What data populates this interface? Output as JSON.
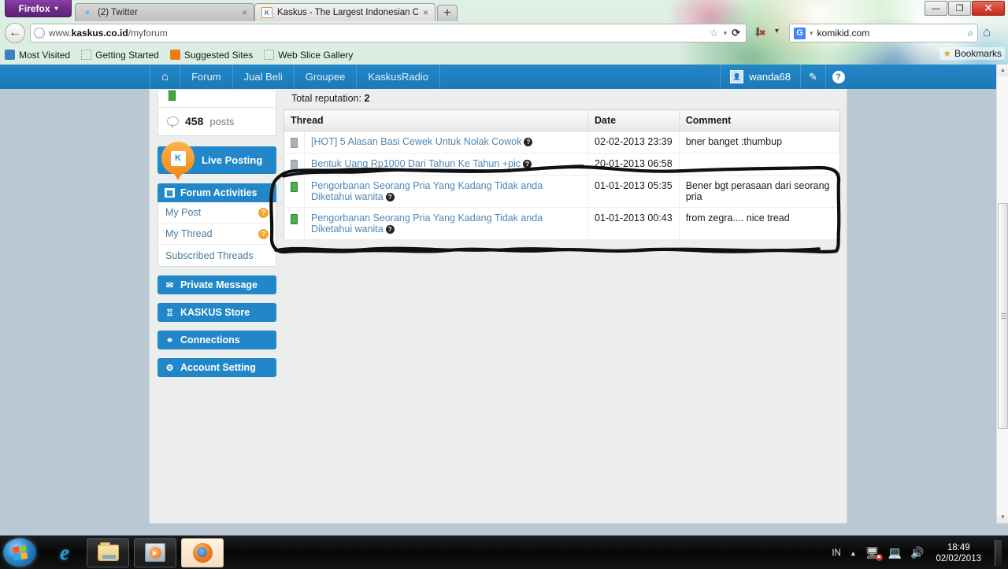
{
  "browser": {
    "app_button": "Firefox",
    "caret": "▾",
    "tabs": [
      {
        "title": "(2) Twitter",
        "favicon": "twitter-icon",
        "close": "×",
        "active": false
      },
      {
        "title": "Kaskus - The Largest Indonesian Com...",
        "favicon": "kaskus-icon",
        "close": "×",
        "active": true
      }
    ],
    "new_tab_label": "+",
    "window_controls": {
      "minimize": "—",
      "maximize": "❐",
      "close": "✕"
    },
    "back_arrow": "←",
    "url_prefix": "www.",
    "url_domain": "kaskus.co.id",
    "url_path": "/myforum",
    "star_icon": "☆",
    "star_caret": "▾",
    "reload_icon": "⟳",
    "download_icon": "⬇",
    "download_badge": "✖",
    "download_caret": "▾",
    "search_engine": "G",
    "search_engine_caret": "▾",
    "search_value": "komikid.com",
    "search_icon": "⌕",
    "home_icon": "⌂",
    "bookmarks": [
      {
        "label": "Most Visited",
        "icon": "most-visited-icon",
        "glyph": "⌂"
      },
      {
        "label": "Getting Started",
        "icon": "dotted-icon",
        "glyph": ""
      },
      {
        "label": "Suggested Sites",
        "icon": "suggested-sites-icon",
        "glyph": ""
      },
      {
        "label": "Web Slice Gallery",
        "icon": "dotted-icon",
        "glyph": ""
      }
    ],
    "bookmarks_button": "Bookmarks",
    "bookmarks_star": "★"
  },
  "kaskus": {
    "nav": {
      "home_icon": "⌂",
      "items": [
        "Forum",
        "Jual Beli",
        "Groupee",
        "KaskusRadio"
      ],
      "username": "wanda68",
      "edit_icon": "✎",
      "help_icon": "?"
    },
    "sidebar": {
      "posts_count": "458",
      "posts_label": "posts",
      "live_posting": "Live Posting",
      "live_posting_glyph": "K",
      "forum_activities": "Forum Activities",
      "activities": [
        {
          "label": "My Post",
          "badge": "?"
        },
        {
          "label": "My Thread",
          "badge": "?"
        },
        {
          "label": "Subscribed Threads",
          "badge": ""
        }
      ],
      "buttons": [
        {
          "label": "Private Message",
          "icon": "envelope-icon",
          "glyph": "✉"
        },
        {
          "label": "KASKUS Store",
          "icon": "cart-icon",
          "glyph": "🛒"
        },
        {
          "label": "Connections",
          "icon": "connections-icon",
          "glyph": "⚯"
        },
        {
          "label": "Account Setting",
          "icon": "gear-icon",
          "glyph": "✿"
        }
      ]
    },
    "main": {
      "total_reputation_label": "Total reputation:",
      "total_reputation_value": "2",
      "columns": [
        "Thread",
        "Date",
        "Comment"
      ],
      "rows": [
        {
          "chip": "grey",
          "thread": "[HOT] 5 Alasan Basi Cewek Untuk Nolak Cowok",
          "help": "?",
          "date": "02-02-2013 23:39",
          "comment": "bner banget :thumbup"
        },
        {
          "chip": "grey",
          "thread": "Bentuk Uang Rp1000 Dari Tahun Ke Tahun +pic",
          "help": "?",
          "date": "20-01-2013 06:58",
          "comment": ""
        },
        {
          "chip": "green",
          "thread": "Pengorbanan Seorang Pria Yang Kadang Tidak anda Diketahui wanita",
          "help": "?",
          "date": "01-01-2013 05:35",
          "comment": "Bener bgt perasaan dari seorang pria"
        },
        {
          "chip": "green",
          "thread": "Pengorbanan Seorang Pria Yang Kadang Tidak anda Diketahui wanita",
          "help": "?",
          "date": "01-01-2013 00:43",
          "comment": "from zegra.... nice tread"
        }
      ]
    },
    "scrollbar": {
      "up": "▲",
      "down": "▼"
    }
  },
  "taskbar": {
    "start_label": "Start",
    "items": [
      {
        "name": "internet-explorer-icon",
        "label": "Internet Explorer"
      },
      {
        "name": "file-explorer-icon",
        "label": "Windows Explorer"
      },
      {
        "name": "media-player-icon",
        "label": "Windows Media Player"
      },
      {
        "name": "firefox-icon",
        "label": "Mozilla Firefox"
      }
    ],
    "tray": {
      "language": "IN",
      "caret": "▲",
      "network_icon": "🖧",
      "network_badge": "✖",
      "display_icon": "🖵",
      "volume_icon": "🔊",
      "time": "18:49",
      "date": "02/02/2013"
    }
  },
  "colors": {
    "kaskus_blue": "#2287c8",
    "link_blue": "#4f86b4",
    "orange": "#f0a92c",
    "green_chip": "#4caf4c",
    "desktop": "#b9c8d2"
  }
}
